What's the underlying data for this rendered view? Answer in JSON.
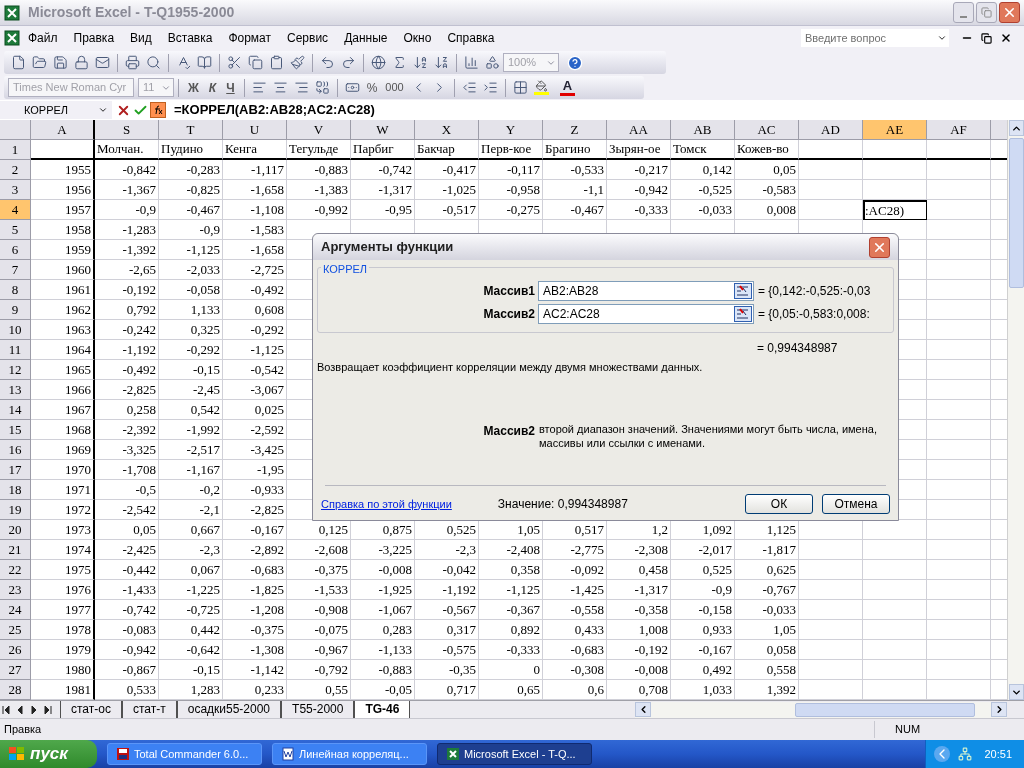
{
  "window": {
    "title": "Microsoft Excel - T-Q1955-2000"
  },
  "menu": [
    "Файл",
    "Правка",
    "Вид",
    "Вставка",
    "Формат",
    "Сервис",
    "Данные",
    "Окно",
    "Справка"
  ],
  "help_box": {
    "placeholder": "Введите вопрос"
  },
  "standard_toolbar": {
    "zoom": {
      "value": "100%",
      "disabled": true
    }
  },
  "format_toolbar": {
    "font": {
      "value": "Times New Roman Cyr",
      "disabled": true
    },
    "size": {
      "value": "11",
      "disabled": true
    },
    "bold": "Ж",
    "italic": "К",
    "underline": "Ч",
    "percent": "%",
    "thousands": "000",
    "font_color": "A"
  },
  "formula_bar": {
    "name_box": "КОРРЕЛ",
    "formula": "=КОРРЕЛ(AB2:AB28;AC2:AC28)"
  },
  "columns": [
    {
      "label": "A",
      "selected": false
    },
    {
      "label": "S",
      "selected": false
    },
    {
      "label": "T",
      "selected": false
    },
    {
      "label": "U",
      "selected": false
    },
    {
      "label": "V",
      "selected": false
    },
    {
      "label": "W",
      "selected": false
    },
    {
      "label": "X",
      "selected": false
    },
    {
      "label": "Y",
      "selected": false
    },
    {
      "label": "Z",
      "selected": false
    },
    {
      "label": "AA",
      "selected": false
    },
    {
      "label": "AB",
      "selected": false
    },
    {
      "label": "AC",
      "selected": false
    },
    {
      "label": "AD",
      "selected": false
    },
    {
      "label": "AE",
      "selected": true
    },
    {
      "label": "AF",
      "selected": false
    }
  ],
  "rows": [
    {
      "label": "1",
      "selected": false,
      "values": [
        "Молчан.",
        "Пудино",
        "Кенга",
        "Тегульде",
        "Парбиг",
        "Бакчар",
        "Перв-кое",
        "Брагино",
        "Зырян-ое",
        "Томск",
        "Кожев-во"
      ]
    },
    {
      "label": "2",
      "selected": false,
      "year": "1955",
      "values": [
        "-0,842",
        "-0,283",
        "-1,117",
        "-0,883",
        "-0,742",
        "-0,417",
        "-0,117",
        "-0,533",
        "-0,217",
        "0,142",
        "0,05"
      ]
    },
    {
      "label": "3",
      "selected": false,
      "year": "1956",
      "values": [
        "-1,367",
        "-0,825",
        "-1,658",
        "-1,383",
        "-1,317",
        "-1,025",
        "-0,958",
        "-1,1",
        "-0,942",
        "-0,525",
        "-0,583"
      ]
    },
    {
      "label": "4",
      "selected": true,
      "year": "1957",
      "values": [
        "-0,9",
        "-0,467",
        "-1,108",
        "-0,992",
        "-0,95",
        "-0,517",
        "-0,275",
        "-0,467",
        "-0,333",
        "-0,033",
        "0,008"
      ],
      "edit_text": ":AC28)"
    },
    {
      "label": "5",
      "selected": false,
      "year": "1958",
      "values": [
        "-1,283",
        "-0,9",
        "-1,583"
      ]
    },
    {
      "label": "6",
      "selected": false,
      "year": "1959",
      "values": [
        "-1,392",
        "-1,125",
        "-1,658"
      ]
    },
    {
      "label": "7",
      "selected": false,
      "year": "1960",
      "values": [
        "-2,65",
        "-2,033",
        "-2,725"
      ]
    },
    {
      "label": "8",
      "selected": false,
      "year": "1961",
      "values": [
        "-0,192",
        "-0,058",
        "-0,492"
      ]
    },
    {
      "label": "9",
      "selected": false,
      "year": "1962",
      "values": [
        "0,792",
        "1,133",
        "0,608"
      ]
    },
    {
      "label": "10",
      "selected": false,
      "year": "1963",
      "values": [
        "-0,242",
        "0,325",
        "-0,292"
      ]
    },
    {
      "label": "11",
      "selected": false,
      "year": "1964",
      "values": [
        "-1,192",
        "-0,292",
        "-1,125"
      ]
    },
    {
      "label": "12",
      "selected": false,
      "year": "1965",
      "values": [
        "-0,492",
        "-0,15",
        "-0,542"
      ]
    },
    {
      "label": "13",
      "selected": false,
      "year": "1966",
      "values": [
        "-2,825",
        "-2,45",
        "-3,067"
      ]
    },
    {
      "label": "14",
      "selected": false,
      "year": "1967",
      "values": [
        "0,258",
        "0,542",
        "0,025"
      ]
    },
    {
      "label": "15",
      "selected": false,
      "year": "1968",
      "values": [
        "-2,392",
        "-1,992",
        "-2,592"
      ]
    },
    {
      "label": "16",
      "selected": false,
      "year": "1969",
      "values": [
        "-3,325",
        "-2,517",
        "-3,425"
      ]
    },
    {
      "label": "17",
      "selected": false,
      "year": "1970",
      "values": [
        "-1,708",
        "-1,167",
        "-1,95"
      ]
    },
    {
      "label": "18",
      "selected": false,
      "year": "1971",
      "values": [
        "-0,5",
        "-0,2",
        "-0,933"
      ]
    },
    {
      "label": "19",
      "selected": false,
      "year": "1972",
      "values": [
        "-2,542",
        "-2,1",
        "-2,825"
      ]
    },
    {
      "label": "20",
      "selected": false,
      "year": "1973",
      "values": [
        "0,05",
        "0,667",
        "-0,167",
        "0,125",
        "0,875",
        "0,525",
        "1,05",
        "0,517",
        "1,2",
        "1,092",
        "1,125"
      ]
    },
    {
      "label": "21",
      "selected": false,
      "year": "1974",
      "values": [
        "-2,425",
        "-2,3",
        "-2,892",
        "-2,608",
        "-3,225",
        "-2,3",
        "-2,408",
        "-2,775",
        "-2,308",
        "-2,017",
        "-1,817"
      ]
    },
    {
      "label": "22",
      "selected": false,
      "year": "1975",
      "values": [
        "-0,442",
        "0,067",
        "-0,683",
        "-0,375",
        "-0,008",
        "-0,042",
        "0,358",
        "-0,092",
        "0,458",
        "0,525",
        "0,625"
      ]
    },
    {
      "label": "23",
      "selected": false,
      "year": "1976",
      "values": [
        "-1,433",
        "-1,225",
        "-1,825",
        "-1,533",
        "-1,925",
        "-1,192",
        "-1,125",
        "-1,425",
        "-1,317",
        "-0,9",
        "-0,767"
      ]
    },
    {
      "label": "24",
      "selected": false,
      "year": "1977",
      "values": [
        "-0,742",
        "-0,725",
        "-1,208",
        "-0,908",
        "-1,067",
        "-0,567",
        "-0,367",
        "-0,558",
        "-0,358",
        "-0,158",
        "-0,033"
      ]
    },
    {
      "label": "25",
      "selected": false,
      "year": "1978",
      "values": [
        "-0,083",
        "0,442",
        "-0,375",
        "-0,075",
        "0,283",
        "0,317",
        "0,892",
        "0,433",
        "1,008",
        "0,933",
        "1,05"
      ]
    },
    {
      "label": "26",
      "selected": false,
      "year": "1979",
      "values": [
        "-0,942",
        "-0,642",
        "-1,308",
        "-0,967",
        "-1,133",
        "-0,575",
        "-0,333",
        "-0,683",
        "-0,192",
        "-0,167",
        "0,058"
      ]
    },
    {
      "label": "27",
      "selected": false,
      "year": "1980",
      "values": [
        "-0,867",
        "-0,15",
        "-1,142",
        "-0,792",
        "-0,883",
        "-0,35",
        "0",
        "-0,308",
        "-0,008",
        "0,492",
        "0,558"
      ]
    },
    {
      "label": "28",
      "selected": false,
      "year": "1981",
      "values": [
        "0,533",
        "1,283",
        "0,233",
        "0,55",
        "-0,05",
        "0,717",
        "0,65",
        "0,6",
        "0,708",
        "1,033",
        "1,392"
      ]
    }
  ],
  "dialog": {
    "title": "Аргументы функции",
    "function": "КОРРЕЛ",
    "arguments": [
      {
        "label": "Массив1",
        "value": "AB2:AB28",
        "result": "= {0,142:-0,525:-0,03"
      },
      {
        "label": "Массив2",
        "value": "AC2:AC28",
        "result": "= {0,05:-0,583:0,008:"
      }
    ],
    "result": "= 0,994348987",
    "description": "Возвращает коэффициент корреляции между двумя множествами данных.",
    "argument_help": {
      "label": "Массив2",
      "text": "второй диапазон значений. Значениями могут быть числа, имена, массивы или ссылки с именами."
    },
    "help_link": "Справка по этой функции",
    "value": "Значение: 0,994348987",
    "ok": "ОК",
    "cancel": "Отмена"
  },
  "sheet_tabs": [
    {
      "label": "стат-ос",
      "selected": false
    },
    {
      "label": "стат-т",
      "selected": false
    },
    {
      "label": "осадки55-2000",
      "selected": false
    },
    {
      "label": "T55-2000",
      "selected": false
    },
    {
      "label": "TG-46",
      "selected": true
    }
  ],
  "status_bar": {
    "mode": "Правка",
    "num": "NUM"
  },
  "taskbar": {
    "start": "пуск",
    "tasks": [
      {
        "label": "Total Commander 6.0...",
        "kind": "commander",
        "selected": false
      },
      {
        "label": "Линейная корреляц...",
        "kind": "word",
        "selected": false
      },
      {
        "label": "Microsoft Excel - T-Q...",
        "kind": "excel",
        "selected": true
      }
    ],
    "clock": "20:51"
  }
}
